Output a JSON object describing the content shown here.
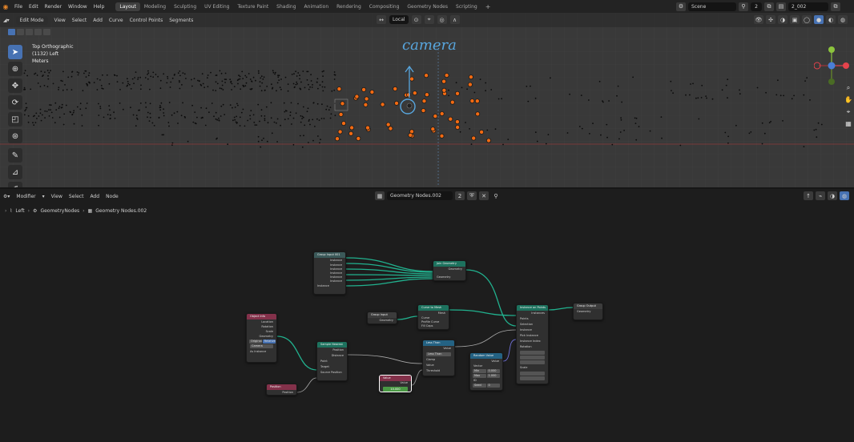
{
  "topbar": {
    "menus": [
      "File",
      "Edit",
      "Render",
      "Window",
      "Help"
    ],
    "workspaces": [
      "Layout",
      "Modeling",
      "Sculpting",
      "UV Editing",
      "Texture Paint",
      "Shading",
      "Animation",
      "Rendering",
      "Compositing",
      "Geometry Nodes",
      "Scripting"
    ],
    "active_workspace": "Layout",
    "scene_label": "Scene",
    "frame_value": "2",
    "view_layer": "2_002"
  },
  "viewport": {
    "mode": "Edit Mode",
    "menus": [
      "View",
      "Select",
      "Add",
      "Curve",
      "Control Points",
      "Segments"
    ],
    "transform": "Local",
    "view_name": "Top Orthographic",
    "context": "(1132) Left",
    "units": "Meters",
    "annotation": "camera"
  },
  "node_editor": {
    "editor_type": "Modifier",
    "menus": [
      "View",
      "Select",
      "Add",
      "Node"
    ],
    "tree_name": "Geometry Nodes.002",
    "users": "2",
    "breadcrumb": [
      "Left",
      "GeometryNodes",
      "Geometry Nodes.002"
    ],
    "nodes": {
      "group_input": {
        "title": "Group Input 001",
        "rows": [
          "Instance",
          "Instance",
          "Instance",
          "Instance",
          "Instance",
          "Instance"
        ],
        "footer": "Instance"
      },
      "join": {
        "title": "Join Geometry",
        "out": "Geometry",
        "in": "Geometry"
      },
      "group_input2": {
        "title": "Group Input",
        "out": "Geometry"
      },
      "mesh": {
        "title": "Curve to Mesh",
        "out": "Mesh",
        "rows": [
          "Curve",
          "Profile Curve",
          "Fill Caps"
        ]
      },
      "object_info": {
        "title": "Object Info",
        "rows": [
          "Location",
          "Rotation",
          "Scale",
          "Geometry"
        ],
        "buttons": [
          "Original",
          "Relative"
        ],
        "field": "Camera",
        "check": "As Instance"
      },
      "distance": {
        "title": "Sample Nearest",
        "rows": [
          "Position",
          "Distance",
          "Point",
          "Target",
          "Source Position"
        ]
      },
      "less": {
        "title": "Less Than",
        "out": "Value",
        "rows": [
          "Less Than",
          "Clamp",
          "Value",
          "Threshold"
        ]
      },
      "float": {
        "title": "Value",
        "out": "Value",
        "value": "10.000"
      },
      "position": {
        "title": "Position",
        "out": "Position"
      },
      "instance": {
        "title": "Instance on Points",
        "out": "Instances",
        "rows": [
          "Points",
          "Selection",
          "Instance",
          "Pick Instance",
          "Instance Index",
          "Rotation",
          "Scale"
        ]
      },
      "output": {
        "title": "Group Output",
        "in": "Geometry"
      },
      "vector": {
        "title": "Random Value",
        "out": "Value",
        "rows": [
          "Vector",
          "Min",
          "Max",
          "ID",
          "Seed"
        ],
        "min": "0.000",
        "max": "1.000",
        "seed": "0"
      }
    }
  }
}
